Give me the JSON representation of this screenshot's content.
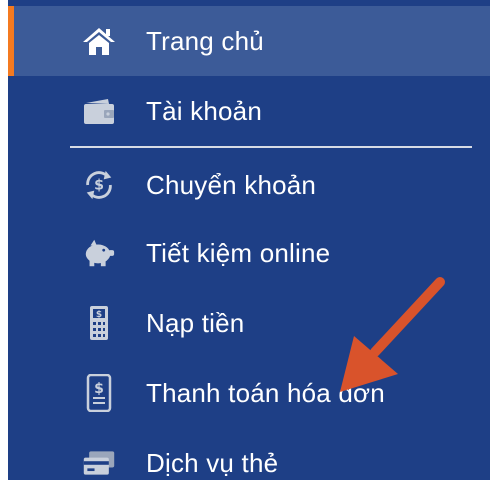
{
  "sidebar": {
    "items": [
      {
        "label": "Trang chủ",
        "icon": "home-icon",
        "active": true
      },
      {
        "label": "Tài khoản",
        "icon": "wallet-icon",
        "active": false
      },
      {
        "label": "Chuyển khoản",
        "icon": "money-transfer-icon",
        "active": false
      },
      {
        "label": "Tiết kiệm online",
        "icon": "piggy-bank-icon",
        "active": false
      },
      {
        "label": "Nạp tiền",
        "icon": "mobile-topup-icon",
        "active": false
      },
      {
        "label": "Thanh toán hóa đơn",
        "icon": "bill-icon",
        "active": false
      },
      {
        "label": "Dịch vụ thẻ",
        "icon": "card-icon",
        "active": false
      }
    ]
  },
  "colors": {
    "sidebar_bg": "#1e3f86",
    "active_bg": "#3c5b98",
    "accent": "#f47a20",
    "arrow": "#d9532b"
  }
}
